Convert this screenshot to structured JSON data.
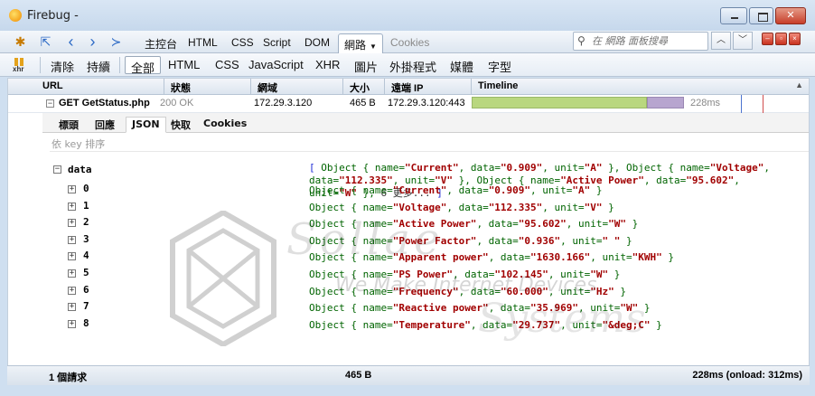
{
  "window": {
    "title": "Firebug -",
    "min_label": "",
    "max_label": "",
    "close_label": "✕"
  },
  "toolbar": {
    "tabs": [
      "主控台",
      "HTML",
      "CSS",
      "Script",
      "DOM",
      "網路",
      "Cookies"
    ],
    "active_tab": "網路",
    "search_placeholder": "在 網路 面板搜尋"
  },
  "net_toolbar": {
    "xhr_label": "xhr",
    "clear": "清除",
    "persist": "持續",
    "filters": [
      "全部",
      "HTML",
      "CSS",
      "JavaScript",
      "XHR",
      "圖片",
      "外掛程式",
      "媒體",
      "字型"
    ],
    "active_filter": "全部"
  },
  "columns": {
    "url": "URL",
    "status": "狀態",
    "domain": "網域",
    "size": "大小",
    "remote_ip": "遠端 IP",
    "timeline": "Timeline"
  },
  "request": {
    "url": "GET GetStatus.php",
    "status": "200 OK",
    "domain": "172.29.3.120",
    "size": "465 B",
    "remote_ip": "172.29.3.120:443",
    "time": "228ms",
    "timeline_fraction_waiting": 0.81,
    "timeline_fraction_receiving": 0.17
  },
  "detail_tabs": [
    "標頭",
    "回應",
    "JSON",
    "快取",
    "Cookies"
  ],
  "active_detail_tab": "JSON",
  "sort_by_key": "依 key 排序",
  "json": {
    "root_key": "data",
    "summary": {
      "line1_pre": "[ Object { name=",
      "v1": "\"Current\"",
      "line1_mid": ", data=",
      "v2": "\"0.909\"",
      "line1_mid2": ", unit=",
      "v3": "\"A\"",
      "line1_end": " }, Object { name=",
      "v4": "\"Voltage\"",
      "line2_pre": ", data=",
      "v5": "\"112.335\"",
      "line2_mid": ", unit=",
      "v6": "\"V\"",
      "line2_mid2": " }, Object { name=",
      "v7": "\"Active Power\"",
      "line2_mid3": ", data=",
      "v8": "\"95.602\"",
      "line3_pre": ", unit=",
      "v9": "\"W\"",
      "line3_end": " }, ",
      "more": "6 更多...",
      "close": " ]"
    },
    "items": [
      {
        "key": "0",
        "name": "\"Current\"",
        "data": "\"0.909\"",
        "unit": "\"A\""
      },
      {
        "key": "1",
        "name": "\"Voltage\"",
        "data": "\"112.335\"",
        "unit": "\"V\""
      },
      {
        "key": "2",
        "name": "\"Active Power\"",
        "data": "\"95.602\"",
        "unit": "\"W\""
      },
      {
        "key": "3",
        "name": "\"Power Factor\"",
        "data": "\"0.936\"",
        "unit": "\" \""
      },
      {
        "key": "4",
        "name": "\"Apparent power\"",
        "data": "\"1630.166\"",
        "unit": "\"KWH\""
      },
      {
        "key": "5",
        "name": "\"PS Power\"",
        "data": "\"102.145\"",
        "unit": "\"W\""
      },
      {
        "key": "6",
        "name": "\"Frequency\"",
        "data": "\"60.000\"",
        "unit": "\"Hz\""
      },
      {
        "key": "7",
        "name": "\"Reactive power\"",
        "data": "\"35.969\"",
        "unit": "\"W\""
      },
      {
        "key": "8",
        "name": "\"Temperature\"",
        "data": "\"29.737\"",
        "unit": "\"&deg;C\""
      }
    ]
  },
  "watermark": {
    "line1": "Sollae",
    "line2": "We Make Internet Devices",
    "line3": "Systems"
  },
  "status": {
    "requests": "1 個請求",
    "size": "465 B",
    "time": "228ms (onload: 312ms)"
  }
}
